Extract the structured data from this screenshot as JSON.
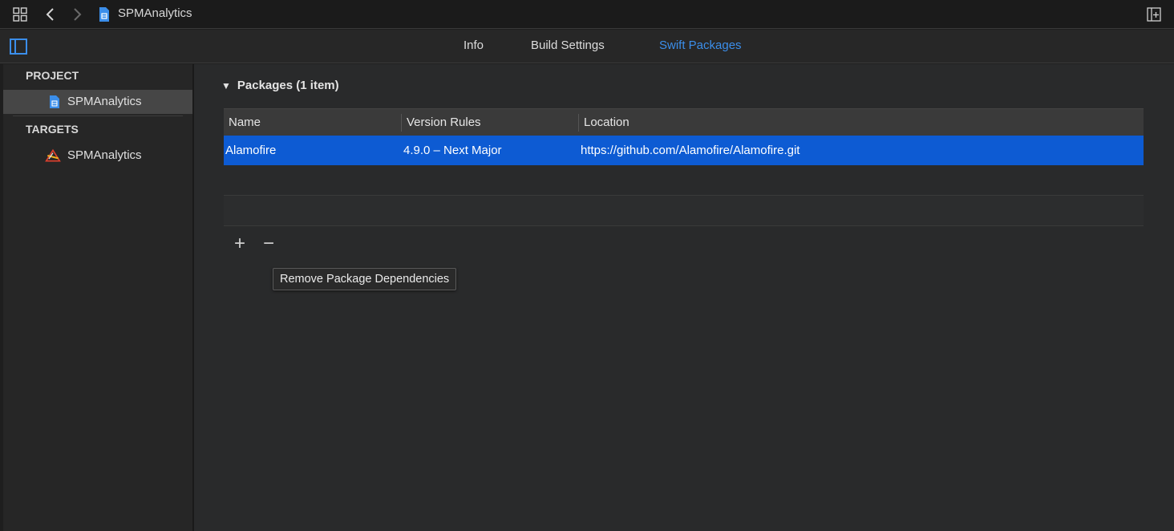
{
  "window": {
    "title": "SPMAnalytics"
  },
  "tabs": [
    {
      "label": "Info"
    },
    {
      "label": "Build Settings"
    },
    {
      "label": "Swift Packages",
      "active": true
    }
  ],
  "sidebar": {
    "project_header": "PROJECT",
    "project_item": "SPMAnalytics",
    "targets_header": "TARGETS",
    "target_item": "SPMAnalytics"
  },
  "packages": {
    "section_title": "Packages (1 item)",
    "columns": [
      "Name",
      "Version Rules",
      "Location"
    ],
    "rows": [
      {
        "name": "Alamofire",
        "version": "4.9.0 – Next Major",
        "location": "https://github.com/Alamofire/Alamofire.git"
      }
    ],
    "add_symbol": "+",
    "remove_symbol": "−"
  },
  "tooltip": "Remove Package Dependencies",
  "colors": {
    "accent": "#3b8eea",
    "selection": "#0d5bd3"
  },
  "icons": [
    "grid-icon",
    "chevron-left-icon",
    "chevron-right-icon",
    "project-file-icon",
    "add-editor-icon",
    "sidebar-toggle-icon",
    "app-target-icon"
  ]
}
